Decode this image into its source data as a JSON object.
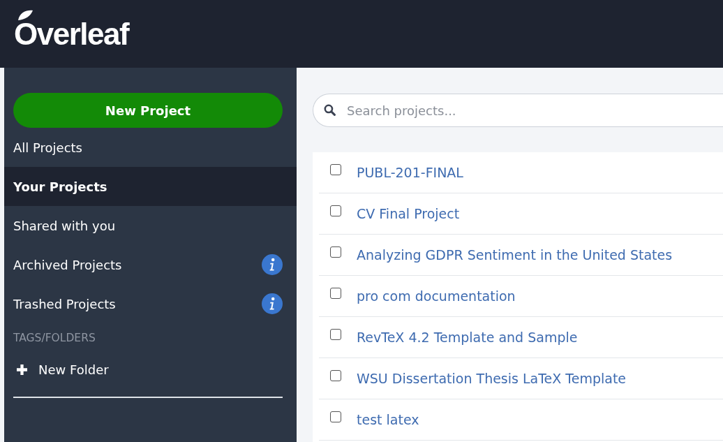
{
  "header": {
    "logo": "Overleaf"
  },
  "sidebar": {
    "new_project": "New Project",
    "items": [
      {
        "label": "All Projects",
        "selected": false,
        "info": false
      },
      {
        "label": "Your Projects",
        "selected": true,
        "info": false
      },
      {
        "label": "Shared with you",
        "selected": false,
        "info": false
      },
      {
        "label": "Archived Projects",
        "selected": false,
        "info": true
      },
      {
        "label": "Trashed Projects",
        "selected": false,
        "info": true
      }
    ],
    "section_title": "TAGS/FOLDERS",
    "new_folder": "New Folder"
  },
  "search": {
    "placeholder": "Search projects..."
  },
  "projects": [
    {
      "name": "PUBL-201-FINAL",
      "checked": false
    },
    {
      "name": "CV Final Project",
      "checked": false
    },
    {
      "name": "Analyzing GDPR Sentiment in the United States",
      "checked": false
    },
    {
      "name": "pro com documentation",
      "checked": false
    },
    {
      "name": "RevTeX 4.2 Template and Sample",
      "checked": false
    },
    {
      "name": "WSU Dissertation Thesis LaTeX Template",
      "checked": false
    },
    {
      "name": "test latex",
      "checked": false
    }
  ]
}
